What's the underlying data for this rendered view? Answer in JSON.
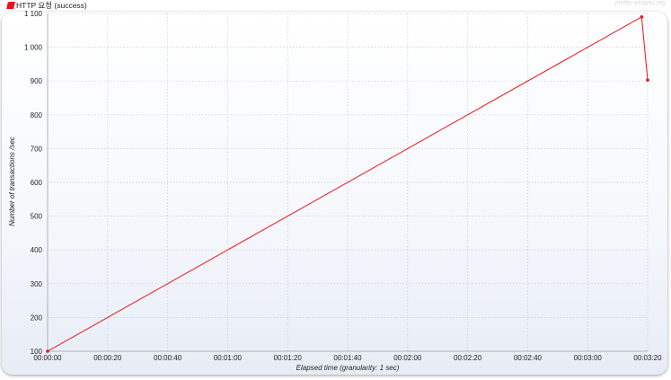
{
  "legend": {
    "label": "HTTP 요청 (success)",
    "color": "#e8141b"
  },
  "watermark": "jmeter-plugins.org",
  "chart_data": {
    "type": "line",
    "xlabel": "Elapsed time (granularity: 1 sec)",
    "ylabel": "Number of transactions /sec",
    "xlim": [
      "00:00:00",
      "00:03:20"
    ],
    "ylim": [
      100,
      1100
    ],
    "grid": true,
    "legend_position": "top-left",
    "x_ticks": [
      "00:00:00",
      "00:00:20",
      "00:00:40",
      "00:01:00",
      "00:01:20",
      "00:01:40",
      "00:02:00",
      "00:02:20",
      "00:02:40",
      "00:03:00",
      "00:03:20"
    ],
    "y_ticks": [
      "100",
      "200",
      "300",
      "400",
      "500",
      "600",
      "700",
      "800",
      "900",
      "1 000",
      "1 100"
    ],
    "series": [
      {
        "name": "HTTP 요청 (success)",
        "color": "#e8141b",
        "x": [
          "00:00:00",
          "00:03:18",
          "00:03:20"
        ],
        "y": [
          100,
          1090,
          903
        ]
      }
    ]
  }
}
